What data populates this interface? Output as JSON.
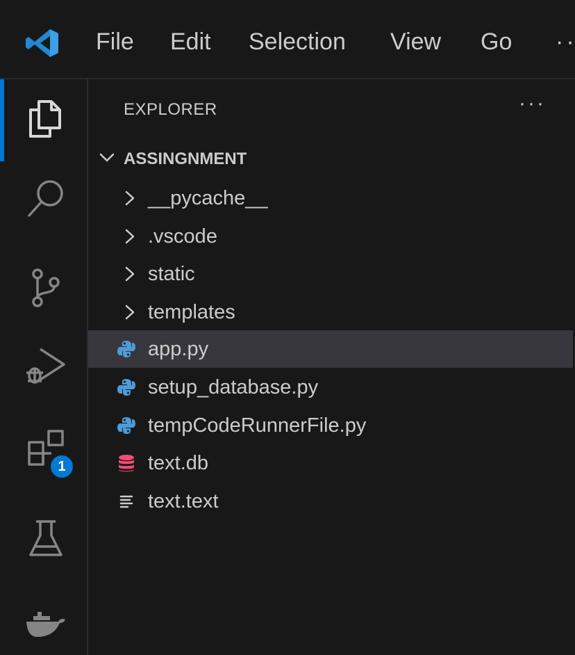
{
  "menu": {
    "file": "File",
    "edit": "Edit",
    "selection": "Selection",
    "view": "View",
    "go": "Go",
    "more": "··"
  },
  "activity_bar": {
    "items": [
      "explorer-icon",
      "search-icon",
      "source-control-icon",
      "run-debug-icon",
      "extensions-icon",
      "testing-icon",
      "docker-icon"
    ],
    "extensions_badge": "1",
    "accent_color": "#0078d4"
  },
  "explorer": {
    "title": "EXPLORER",
    "more": "···",
    "folder": "ASSINGNMENT",
    "items": [
      {
        "label": "__pycache__",
        "type": "folder"
      },
      {
        "label": ".vscode",
        "type": "folder"
      },
      {
        "label": "static",
        "type": "folder"
      },
      {
        "label": "templates",
        "type": "folder"
      },
      {
        "label": "app.py",
        "type": "python",
        "selected": true
      },
      {
        "label": "setup_database.py",
        "type": "python"
      },
      {
        "label": "tempCodeRunnerFile.py",
        "type": "python"
      },
      {
        "label": "text.db",
        "type": "database"
      },
      {
        "label": "text.text",
        "type": "text"
      }
    ]
  },
  "colors": {
    "background": "#181818",
    "selected_row": "#37373d",
    "python_icon": "#4d9bd8",
    "database_icon": "#f14c78"
  }
}
